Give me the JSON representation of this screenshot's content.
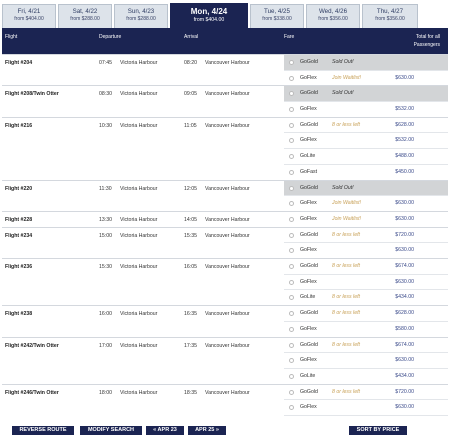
{
  "date_tabs": [
    {
      "day": "Fri, 4/21",
      "price": "from $404.00"
    },
    {
      "day": "Sat, 4/22",
      "price": "from $288.00"
    },
    {
      "day": "Sun, 4/23",
      "price": "from $288.00"
    },
    {
      "day": "Mon, 4/24",
      "price": "from $404.00",
      "active": true
    },
    {
      "day": "Tue, 4/25",
      "price": "from $338.00"
    },
    {
      "day": "Wed, 4/26",
      "price": "from $356.00"
    },
    {
      "day": "Thu, 4/27",
      "price": "from $356.00"
    }
  ],
  "header": {
    "flight": "Flight",
    "departure": "Departure",
    "arrival": "Arrival",
    "fare": "Fare",
    "total_line1": "Total for all",
    "total_line2": "Passengers"
  },
  "flights": [
    {
      "name": "Flight #204",
      "dep_time": "07:45",
      "dep_place": "Victoria Harbour",
      "arr_time": "08:20",
      "arr_place": "Vancouver Harbour",
      "fares": [
        {
          "name": "GoGold",
          "status": "Sold Out!",
          "price": "",
          "sold_out": true
        },
        {
          "name": "GoFlex",
          "status": "Join Waitlist!",
          "price": "$630.00"
        }
      ]
    },
    {
      "name": "Flight #208/Twin Otter",
      "dep_time": "08:30",
      "dep_place": "Victoria Harbour",
      "arr_time": "09:05",
      "arr_place": "Vancouver Harbour",
      "fares": [
        {
          "name": "GoGold",
          "status": "Sold Out!",
          "price": "",
          "sold_out": true
        },
        {
          "name": "GoFlex",
          "status": "",
          "price": "$532.00"
        }
      ]
    },
    {
      "name": "Flight #216",
      "dep_time": "10:30",
      "dep_place": "Victoria Harbour",
      "arr_time": "11:05",
      "arr_place": "Vancouver Harbour",
      "fares": [
        {
          "name": "GoGold",
          "status": "8 or less left",
          "price": "$628.00"
        },
        {
          "name": "GoFlex",
          "status": "",
          "price": "$532.00"
        },
        {
          "name": "GoLite",
          "status": "",
          "price": "$488.00"
        },
        {
          "name": "GoFast",
          "status": "",
          "price": "$450.00"
        }
      ]
    },
    {
      "name": "Flight #220",
      "dep_time": "11:30",
      "dep_place": "Victoria Harbour",
      "arr_time": "12:05",
      "arr_place": "Vancouver Harbour",
      "fares": [
        {
          "name": "GoGold",
          "status": "Sold Out!",
          "price": "",
          "sold_out": true
        },
        {
          "name": "GoFlex",
          "status": "Join Waitlist!",
          "price": "$630.00"
        }
      ]
    },
    {
      "name": "Flight #228",
      "dep_time": "13:30",
      "dep_place": "Victoria Harbour",
      "arr_time": "14:05",
      "arr_place": "Vancouver Harbour",
      "fares": [
        {
          "name": "GoFlex",
          "status": "Join Waitlist!",
          "price": "$630.00"
        }
      ]
    },
    {
      "name": "Flight #234",
      "dep_time": "15:00",
      "dep_place": "Victoria Harbour",
      "arr_time": "15:35",
      "arr_place": "Vancouver Harbour",
      "fares": [
        {
          "name": "GoGold",
          "status": "8 or less left",
          "price": "$720.00"
        },
        {
          "name": "GoFlex",
          "status": "",
          "price": "$630.00"
        }
      ]
    },
    {
      "name": "Flight #236",
      "dep_time": "15:30",
      "dep_place": "Victoria Harbour",
      "arr_time": "16:05",
      "arr_place": "Vancouver Harbour",
      "fares": [
        {
          "name": "GoGold",
          "status": "8 or less left",
          "price": "$674.00"
        },
        {
          "name": "GoFlex",
          "status": "",
          "price": "$630.00"
        },
        {
          "name": "GoLite",
          "status": "8 or less left",
          "price": "$434.00"
        }
      ]
    },
    {
      "name": "Flight #238",
      "dep_time": "16:00",
      "dep_place": "Victoria Harbour",
      "arr_time": "16:35",
      "arr_place": "Vancouver Harbour",
      "fares": [
        {
          "name": "GoGold",
          "status": "8 or less left",
          "price": "$628.00"
        },
        {
          "name": "GoFlex",
          "status": "",
          "price": "$580.00"
        }
      ]
    },
    {
      "name": "Flight #242/Twin Otter",
      "dep_time": "17:00",
      "dep_place": "Victoria Harbour",
      "arr_time": "17:35",
      "arr_place": "Vancouver Harbour",
      "fares": [
        {
          "name": "GoGold",
          "status": "8 or less left",
          "price": "$674.00"
        },
        {
          "name": "GoFlex",
          "status": "",
          "price": "$630.00"
        },
        {
          "name": "GoLite",
          "status": "",
          "price": "$434.00"
        }
      ]
    },
    {
      "name": "Flight #246/Twin Otter",
      "dep_time": "18:00",
      "dep_place": "Victoria Harbour",
      "arr_time": "18:35",
      "arr_place": "Vancouver Harbour",
      "fares": [
        {
          "name": "GoGold",
          "status": "8 or less left",
          "price": "$720.00"
        },
        {
          "name": "GoFlex",
          "status": "",
          "price": "$630.00"
        }
      ]
    }
  ],
  "buttons": {
    "reverse": "REVERSE ROUTE",
    "modify": "MODIFY SEARCH",
    "prev": "« APR 23",
    "next": "APR 25 »",
    "sort": "SORT BY PRICE"
  },
  "colors": {
    "navy": "#1b2452",
    "sold_out_bg": "#d2d4d6",
    "status_gold": "#c8a158",
    "price_blue": "#3a4a8a"
  }
}
